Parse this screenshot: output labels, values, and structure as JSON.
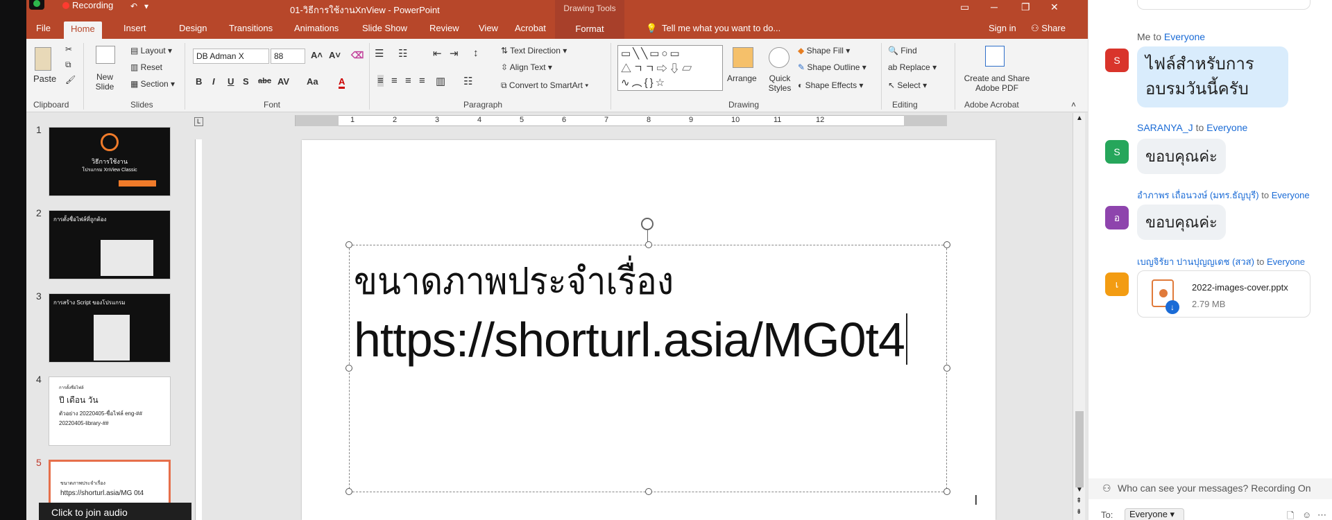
{
  "window": {
    "recording": "Recording",
    "title": "01-วิธีการใช้งานXnView - PowerPoint",
    "contextual_tools": "Drawing Tools"
  },
  "tabs": [
    "File",
    "Home",
    "Insert",
    "Design",
    "Transitions",
    "Animations",
    "Slide Show",
    "Review",
    "View",
    "Acrobat"
  ],
  "format_tab": "Format",
  "tell_me": "Tell me what you want to do...",
  "sign_in": "Sign in",
  "share": "Share",
  "ribbon": {
    "clipboard": {
      "paste": "Paste",
      "label": "Clipboard"
    },
    "slides": {
      "new_slide": "New Slide",
      "layout": "Layout",
      "reset": "Reset",
      "section": "Section",
      "label": "Slides"
    },
    "font": {
      "name": "DB Adman X",
      "size": "88",
      "label": "Font"
    },
    "paragraph": {
      "text_direction": "Text Direction",
      "align_text": "Align Text",
      "convert_smartart": "Convert to SmartArt",
      "label": "Paragraph"
    },
    "drawing": {
      "arrange": "Arrange",
      "quick_styles": "Quick Styles",
      "shape_fill": "Shape Fill",
      "shape_outline": "Shape Outline",
      "shape_effects": "Shape Effects",
      "label": "Drawing"
    },
    "editing": {
      "find": "Find",
      "replace": "Replace",
      "select": "Select",
      "label": "Editing"
    },
    "acrobat": {
      "create_share": "Create and Share Adobe PDF",
      "label": "Adobe Acrobat"
    }
  },
  "ruler_ticks": [
    "12",
    "11",
    "10",
    "9",
    "8",
    "7",
    "6",
    "5",
    "4",
    "3",
    "2",
    "1",
    "1",
    "2",
    "3",
    "4",
    "5",
    "6",
    "7",
    "8",
    "9",
    "10",
    "11",
    "12"
  ],
  "slides": [
    {
      "num": "1",
      "theme": "dark",
      "title": "วิธีการใช้งาน",
      "subtitle": "โปรแกรม XnView Classic"
    },
    {
      "num": "2",
      "theme": "dark",
      "title": "การตั้งชื่อไฟล์ที่ถูกต้อง"
    },
    {
      "num": "3",
      "theme": "dark",
      "title": "การสร้าง Script ของโปรแกรม"
    },
    {
      "num": "4",
      "theme": "white",
      "title": "การตั้งชื่อไฟล์",
      "l1": "ปี เดือน วัน",
      "l2": "ตัวอย่าง 20220405-ชื่อไฟล์ eng-##",
      "l3": "20220405-library-##"
    },
    {
      "num": "5",
      "theme": "white",
      "title": "ขนาดภาพประจำเรื่อง",
      "l1": "https://shorturl.asia/MG 0t4"
    }
  ],
  "main_slide": {
    "line1": "ขนาดภาพประจำเรื่อง",
    "line2": "https://shorturl.asia/MG0t4"
  },
  "tooltip": "Click to join audio",
  "chat": {
    "messages": [
      {
        "sender": "Me",
        "to": "Everyone",
        "avatar": "S",
        "color": "#d9342b",
        "text": "ไฟล์สำหรับการอบรมวันนี้ครับ"
      },
      {
        "sender": "SARANYA_J",
        "to": "Everyone",
        "avatar": "S",
        "color": "#26a65b",
        "text": "ขอบคุณค่ะ"
      },
      {
        "sender": "อำภาพร เถื่อนวงษ์ (มทร.ธัญบุรี)",
        "to": "Everyone",
        "avatar": "อ",
        "color": "#8e44ad",
        "text": "ขอบคุณค่ะ"
      },
      {
        "sender": "เบญจิรัยา ปานปุญญเดช (สวส)",
        "to": "Everyone",
        "avatar": "เ",
        "color": "#f39c12",
        "file_name": "2022-images-cover.pptx",
        "file_size": "2.79 MB"
      }
    ],
    "to_word": "to",
    "notice": "Who can see your messages? Recording On",
    "to_label": "To:",
    "to_value": "Everyone"
  }
}
